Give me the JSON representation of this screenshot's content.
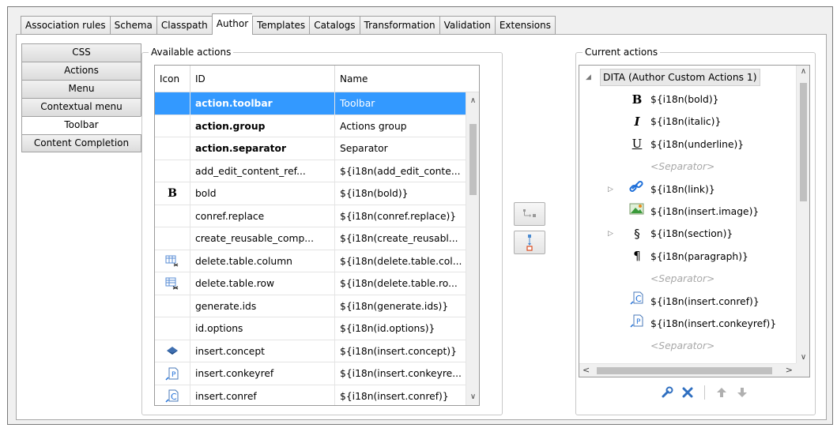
{
  "top_tabs": [
    "Association rules",
    "Schema",
    "Classpath",
    "Author",
    "Templates",
    "Catalogs",
    "Transformation",
    "Validation",
    "Extensions"
  ],
  "side_tabs": [
    "CSS",
    "Actions",
    "Menu",
    "Contextual menu",
    "Toolbar",
    "Content Completion"
  ],
  "available": {
    "title": "Available actions",
    "columns": {
      "icon": "Icon",
      "id": "ID",
      "name": "Name"
    },
    "rows": [
      {
        "icon": "",
        "id": "action.toolbar",
        "name": "Toolbar"
      },
      {
        "icon": "",
        "id": "action.group",
        "name": "Actions group"
      },
      {
        "icon": "",
        "id": "action.separator",
        "name": "Separator"
      },
      {
        "icon": "",
        "id": "add_edit_content_ref...",
        "name": "${i18n(add_edit_conte..."
      },
      {
        "icon": "bold-icon",
        "id": "bold",
        "name": "${i18n(bold)}"
      },
      {
        "icon": "",
        "id": "conref.replace",
        "name": "${i18n(conref.replace)}"
      },
      {
        "icon": "",
        "id": "create_reusable_comp...",
        "name": "${i18n(create_reusabl..."
      },
      {
        "icon": "delete-column-icon",
        "id": "delete.table.column",
        "name": "${i18n(delete.table.col..."
      },
      {
        "icon": "delete-row-icon",
        "id": "delete.table.row",
        "name": "${i18n(delete.table.ro..."
      },
      {
        "icon": "",
        "id": "generate.ids",
        "name": "${i18n(generate.ids)}"
      },
      {
        "icon": "",
        "id": "id.options",
        "name": "${i18n(id.options)}"
      },
      {
        "icon": "concept-icon",
        "id": "insert.concept",
        "name": "${i18n(insert.concept)}"
      },
      {
        "icon": "conkeyref-icon",
        "id": "insert.conkeyref",
        "name": "${i18n(insert.conkeyre..."
      },
      {
        "icon": "conref-icon",
        "id": "insert.conref",
        "name": "${i18n(insert.conref)}"
      }
    ]
  },
  "current": {
    "title": "Current actions",
    "root": "DITA (Author Custom Actions 1)",
    "items": [
      {
        "icon": "bold-icon",
        "glyph": "B",
        "label": "${i18n(bold)}",
        "separator": false
      },
      {
        "icon": "italic-icon",
        "glyph": "I",
        "label": "${i18n(italic)}",
        "separator": false
      },
      {
        "icon": "underline-icon",
        "glyph": "U",
        "label": "${i18n(underline)}",
        "separator": false
      },
      {
        "icon": "",
        "glyph": "",
        "label": "<Separator>",
        "separator": true
      },
      {
        "icon": "link-icon",
        "glyph": "",
        "label": "${i18n(link)}",
        "separator": false
      },
      {
        "icon": "image-icon",
        "glyph": "",
        "label": "${i18n(insert.image)}",
        "separator": false
      },
      {
        "icon": "section-icon",
        "glyph": "§",
        "label": "${i18n(section)}",
        "separator": false
      },
      {
        "icon": "paragraph-icon",
        "glyph": "¶",
        "label": "${i18n(paragraph)}",
        "separator": false
      },
      {
        "icon": "",
        "glyph": "",
        "label": "<Separator>",
        "separator": true
      },
      {
        "icon": "conref-icon",
        "glyph": "",
        "label": "${i18n(insert.conref)}",
        "separator": false
      },
      {
        "icon": "conkeyref-icon",
        "glyph": "",
        "label": "${i18n(insert.conkeyref)}",
        "separator": false
      },
      {
        "icon": "",
        "glyph": "",
        "label": "<Separator>",
        "separator": true
      }
    ]
  },
  "colors": {
    "selection": "#3399ff",
    "accent_blue": "#1e6fd9"
  }
}
